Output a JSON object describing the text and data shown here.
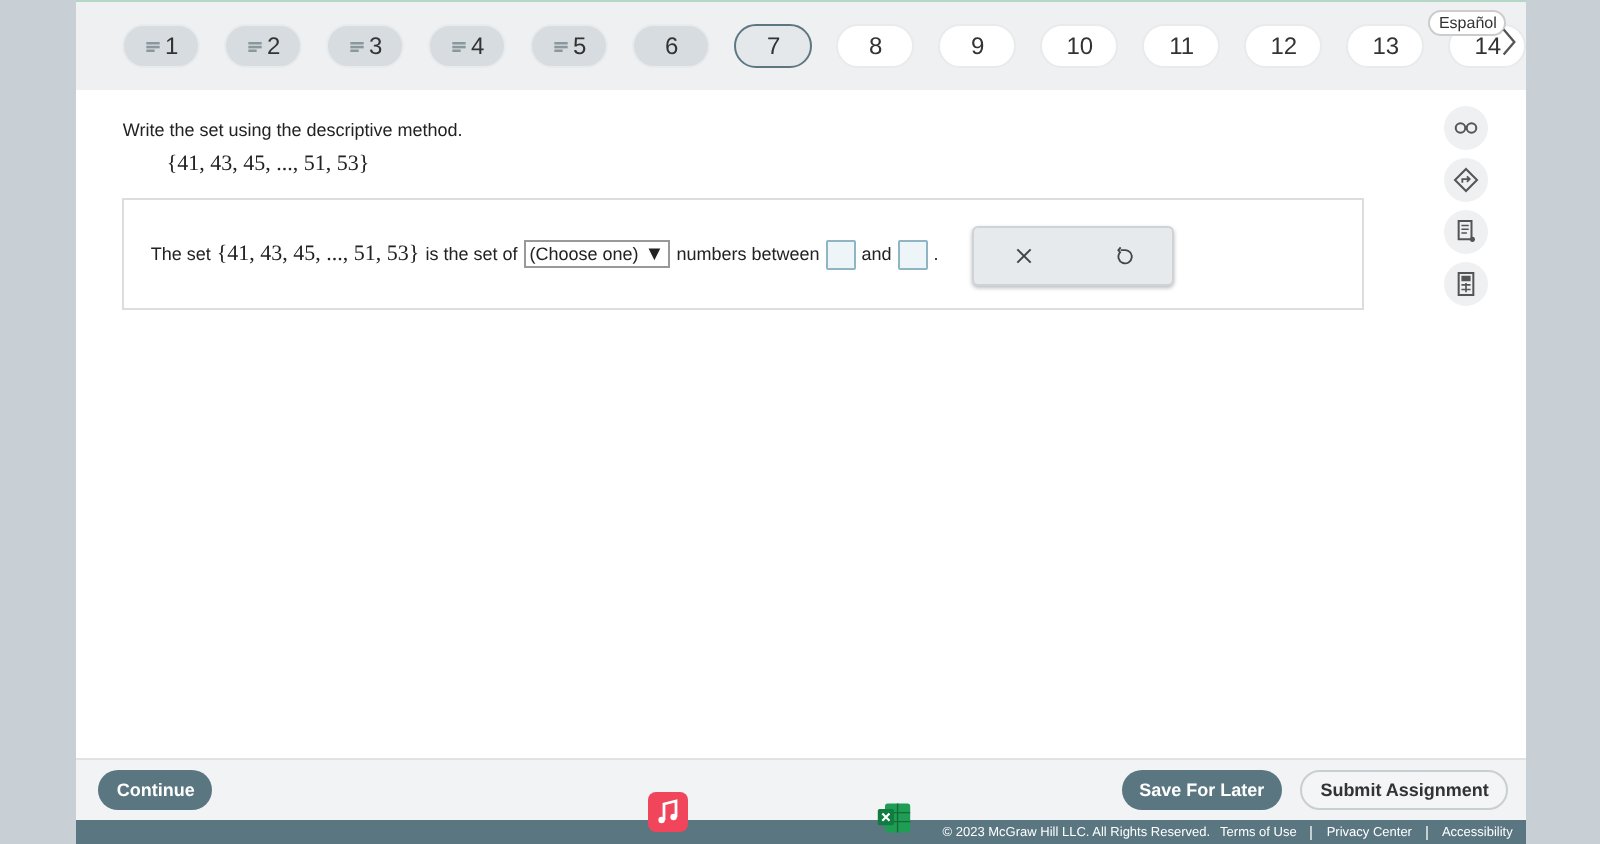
{
  "nav": {
    "questions": [
      {
        "label": "1",
        "answered": true,
        "visited": true,
        "selected": false
      },
      {
        "label": "2",
        "answered": true,
        "visited": true,
        "selected": false
      },
      {
        "label": "3",
        "answered": true,
        "visited": true,
        "selected": false
      },
      {
        "label": "4",
        "answered": true,
        "visited": true,
        "selected": false
      },
      {
        "label": "5",
        "answered": true,
        "visited": true,
        "selected": false
      },
      {
        "label": "6",
        "answered": false,
        "visited": true,
        "selected": false
      },
      {
        "label": "7",
        "answered": false,
        "visited": true,
        "selected": true
      },
      {
        "label": "8",
        "answered": false,
        "visited": false,
        "selected": false
      },
      {
        "label": "9",
        "answered": false,
        "visited": false,
        "selected": false
      },
      {
        "label": "10",
        "answered": false,
        "visited": false,
        "selected": false
      },
      {
        "label": "11",
        "answered": false,
        "visited": false,
        "selected": false
      },
      {
        "label": "12",
        "answered": false,
        "visited": false,
        "selected": false
      },
      {
        "label": "13",
        "answered": false,
        "visited": false,
        "selected": false
      },
      {
        "label": "14",
        "answered": false,
        "visited": false,
        "selected": false
      }
    ],
    "language": "Español"
  },
  "question": {
    "instruction": "Write the set using the descriptive method.",
    "set": "{41, 43, 45, ..., 51, 53}",
    "answer": {
      "lead": "The set",
      "set": "{41, 43, 45, ..., 51, 53}",
      "middle": "is the set of",
      "dropdown": "(Choose one)",
      "dropdown_arrow": "▼",
      "between": "numbers between",
      "and": "and",
      "end": "."
    }
  },
  "bottom": {
    "continue": "Continue",
    "save": "Save For Later",
    "submit": "Submit Assignment"
  },
  "footer": {
    "copyright": "© 2023 McGraw Hill LLC. All Rights Reserved.",
    "links": [
      "Terms of Use",
      "Privacy Center",
      "Accessibility"
    ]
  }
}
